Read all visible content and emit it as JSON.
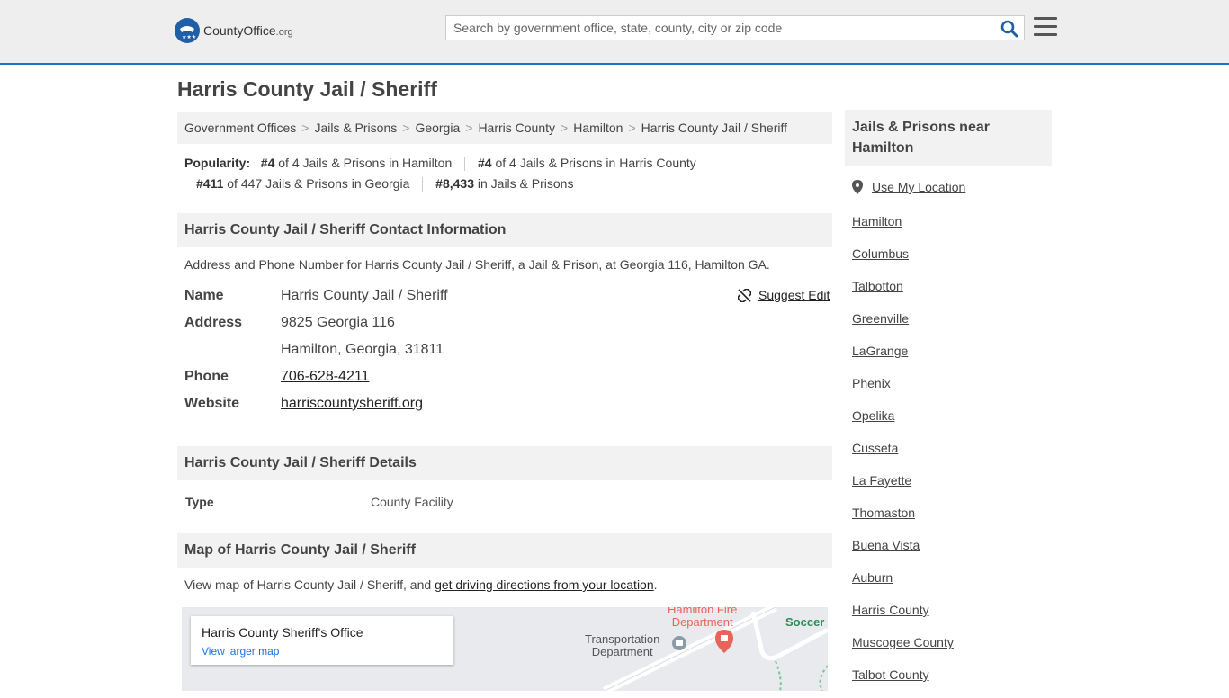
{
  "header": {
    "logo_text": "CountyOffice",
    "logo_suffix": ".org",
    "search_placeholder": "Search by government office, state, county, city or zip code"
  },
  "page_title": "Harris County Jail / Sheriff",
  "breadcrumb": [
    "Government Offices",
    "Jails & Prisons",
    "Georgia",
    "Harris County",
    "Hamilton",
    "Harris County Jail / Sheriff"
  ],
  "popularity": {
    "label": "Popularity:",
    "items": [
      {
        "rank": "#4",
        "text": "of 4 Jails & Prisons in Hamilton"
      },
      {
        "rank": "#4",
        "text": "of 4 Jails & Prisons in Harris County"
      },
      {
        "rank": "#411",
        "text": "of 447 Jails & Prisons in Georgia"
      },
      {
        "rank": "#8,433",
        "text": "in Jails & Prisons"
      }
    ]
  },
  "contact": {
    "heading": "Harris County Jail / Sheriff Contact Information",
    "description": "Address and Phone Number for Harris County Jail / Sheriff, a Jail & Prison, at Georgia 116, Hamilton GA.",
    "name_label": "Name",
    "name_value": "Harris County Jail / Sheriff",
    "address_label": "Address",
    "address_line1": "9825 Georgia 116",
    "address_line2": "Hamilton, Georgia, 31811",
    "phone_label": "Phone",
    "phone_value": "706-628-4211",
    "website_label": "Website",
    "website_value": "harriscountysheriff.org",
    "suggest_edit": "Suggest Edit"
  },
  "details": {
    "heading": "Harris County Jail / Sheriff Details",
    "type_label": "Type",
    "type_value": "County Facility"
  },
  "map_section": {
    "heading": "Map of Harris County Jail / Sheriff",
    "description_prefix": "View map of Harris County Jail / Sheriff, and ",
    "directions_link": "get driving directions from your location",
    "description_suffix": ".",
    "card_title": "Harris County Sheriff's Office",
    "card_link": "View larger map",
    "labels": {
      "fire_dept_line1": "Hamilton Fire",
      "fire_dept_line2": "Department",
      "transport_line1": "Transportation",
      "transport_line2": "Department",
      "soccer": "Soccer"
    }
  },
  "sidebar": {
    "heading_line1": "Jails & Prisons near",
    "heading_line2": "Hamilton",
    "use_location": "Use My Location",
    "items": [
      "Hamilton",
      "Columbus",
      "Talbotton",
      "Greenville",
      "LaGrange",
      "Phenix",
      "Opelika",
      "Cusseta",
      "La Fayette",
      "Thomaston",
      "Buena Vista",
      "Auburn",
      "Harris County",
      "Muscogee County",
      "Talbot County"
    ]
  },
  "colors": {
    "accent": "#1a73c9",
    "logo_blue": "#1f5fa8",
    "map_fire": "#e8645a"
  }
}
